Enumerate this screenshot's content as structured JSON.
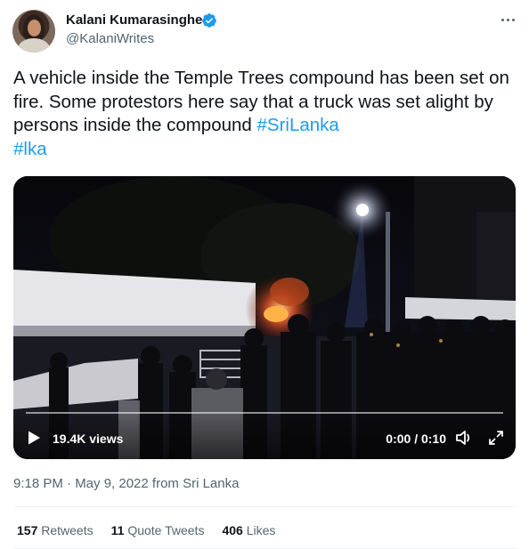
{
  "user": {
    "display_name": "Kalani Kumarasinghe",
    "handle": "@KalaniWrites",
    "verified_icon": "verified-badge-icon",
    "avatar_icon": "avatar"
  },
  "tweet": {
    "text": "A vehicle inside the Temple Trees compound has been set on fire. Some protestors here say that a truck was set alight by persons inside the compound ",
    "hashtags": [
      "#SriLanka",
      "#lka"
    ]
  },
  "video": {
    "views": "19.4K views",
    "time": "0:00 / 0:10",
    "progress": 0
  },
  "meta": {
    "timestamp": "9:18 PM · May 9, 2022 from Sri Lanka"
  },
  "stats": {
    "retweets_count": "157",
    "retweets_label": "Retweets",
    "quote_count": "11",
    "quote_label": "Quote Tweets",
    "likes_count": "406",
    "likes_label": "Likes"
  },
  "colors": {
    "accent": "#1d9bf0",
    "text": "#0f1419",
    "secondary": "#536471",
    "divider": "#eff3f4"
  }
}
